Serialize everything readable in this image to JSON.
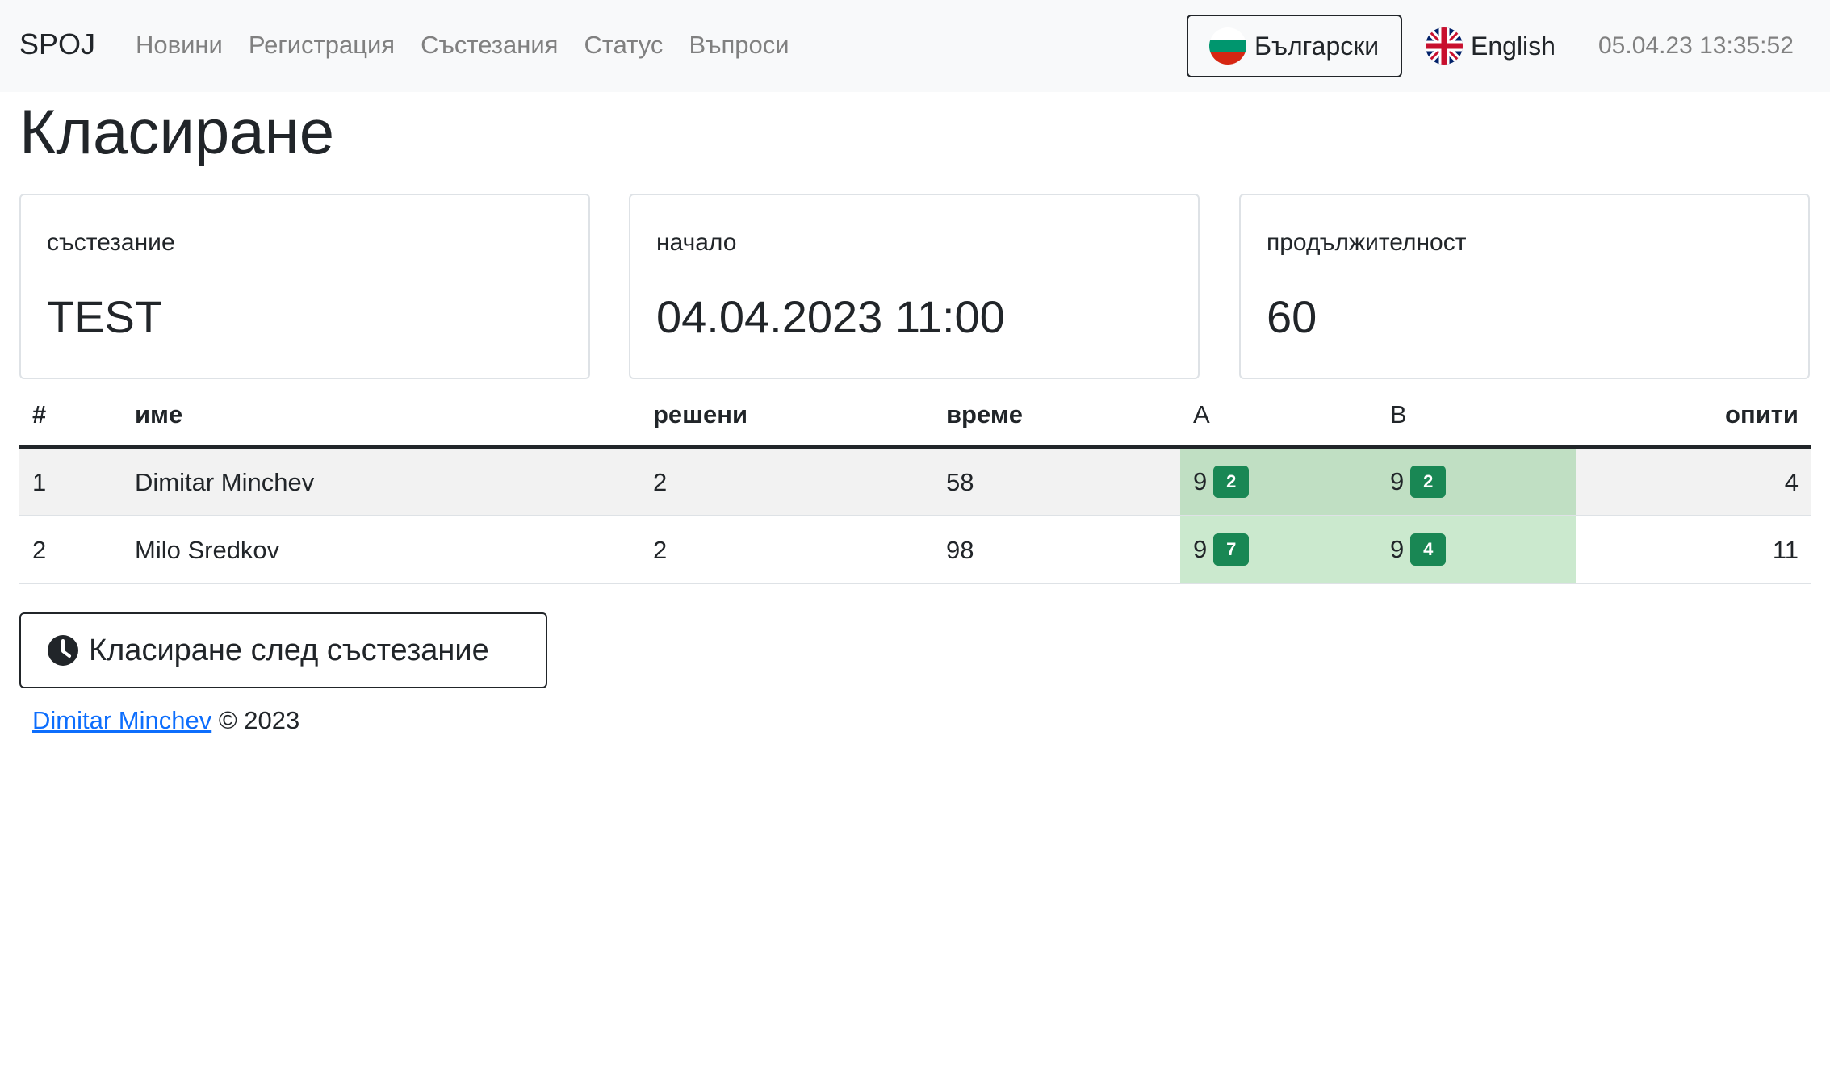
{
  "navbar": {
    "brand": "SPOJ",
    "links": [
      "Новини",
      "Регистрация",
      "Състезания",
      "Статус",
      "Въпроси"
    ],
    "lang_bg": "Български",
    "lang_en": "English",
    "clock": "05.04.23 13:35:52"
  },
  "page": {
    "title": "Класиране"
  },
  "cards": [
    {
      "label": "състезание",
      "value": "TEST"
    },
    {
      "label": "начало",
      "value": "04.04.2023 11:00"
    },
    {
      "label": "продължителност",
      "value": "60"
    }
  ],
  "table": {
    "headers": {
      "rank": "#",
      "name": "име",
      "solved": "решени",
      "time": "време",
      "a": "A",
      "b": "B",
      "attempts": "опити"
    },
    "rows": [
      {
        "rank": "1",
        "name": "Dimitar Minchev",
        "solved": "2",
        "time": "58",
        "a_score": "9",
        "a_tries": "2",
        "b_score": "9",
        "b_tries": "2",
        "attempts": "4"
      },
      {
        "rank": "2",
        "name": "Milo Sredkov",
        "solved": "2",
        "time": "98",
        "a_score": "9",
        "a_tries": "7",
        "b_score": "9",
        "b_tries": "4",
        "attempts": "11"
      }
    ]
  },
  "actions": {
    "after_contest_label": "Класиране след състезание"
  },
  "footer": {
    "author": "Dimitar Minchev",
    "copyright": "© 2023"
  },
  "colors": {
    "solved_cell_odd": "#c0dfc3",
    "solved_cell_even": "#cbe9ce",
    "badge": "#198754",
    "link": "#0d6efd"
  }
}
